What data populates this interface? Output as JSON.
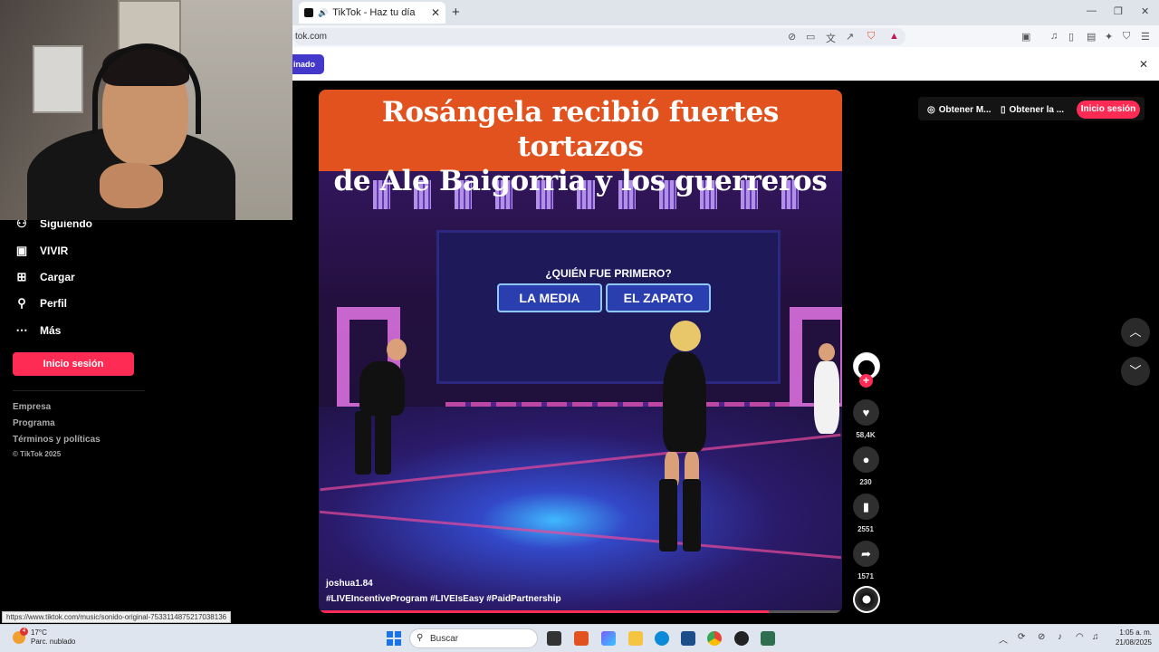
{
  "browser": {
    "tab_title": "TikTok - Haz tu día",
    "url": "tok.com",
    "banner_pill": "inado"
  },
  "sidebar": {
    "items": [
      {
        "label": "Siguiendo",
        "icon": "following-icon"
      },
      {
        "label": "VIVIR",
        "icon": "live-icon"
      },
      {
        "label": "Cargar",
        "icon": "upload-icon"
      },
      {
        "label": "Perfil",
        "icon": "profile-icon"
      },
      {
        "label": "Más",
        "icon": "more-icon"
      }
    ],
    "login_button": "Inicio sesión",
    "footer_links": [
      "Empresa",
      "Programa",
      "Términos y políticas"
    ],
    "copyright": "© TikTok 2025"
  },
  "video": {
    "headline_line1": "Rosángela recibió fuertes tortazos",
    "headline_line2": "de Ale Baigorria y los guerreros",
    "question": "¿QUIÉN FUE PRIMERO?",
    "option_left": "LA MEDIA",
    "option_right": "EL ZAPATO",
    "author": "joshua1.84",
    "hashtags": "#LIVEIncentiveProgram  #LIVEIsEasy  #PaidPartnership",
    "progress": 0.86
  },
  "actions": {
    "likes": "58,4K",
    "comments": "230",
    "saves": "2551",
    "shares": "1571"
  },
  "topbar": {
    "get_app_1": "Obtener M...",
    "get_app_2": "Obtener la ...",
    "signin": "Inicio sesión"
  },
  "status_url": "https://www.tiktok.com/music/sonido-original-7533114875217038136",
  "taskbar": {
    "temperature": "17°C",
    "weather": "Parc. nublado",
    "weather_badge": "4",
    "search_placeholder": "Buscar",
    "time": "1:05 a. m.",
    "date": "21/08/2025"
  },
  "colors": {
    "accent": "#fe2c55",
    "banner": "#e2521f"
  }
}
